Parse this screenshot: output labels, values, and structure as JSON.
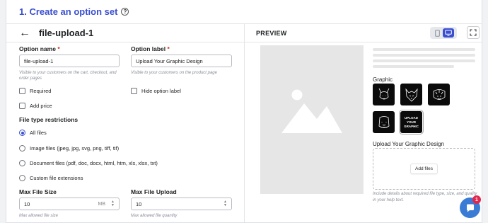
{
  "header": {
    "title": "1. Create an option set",
    "help_glyph": "?"
  },
  "panel": {
    "back_glyph": "←",
    "title": "file-upload-1"
  },
  "form": {
    "option_name": {
      "label": "Option name",
      "required": "*",
      "value": "file-upload-1",
      "help": "Visible to your customers on the cart, checkout, and order pages"
    },
    "option_label": {
      "label": "Option label",
      "required": "*",
      "value": "Upload Your Graphic Design",
      "help": "Visible to your customers on the product page"
    },
    "required_label": "Required",
    "hide_label": "Hide option label",
    "add_price_label": "Add price",
    "file_type_title": "File type restrictions",
    "file_types": [
      {
        "label": "All files",
        "selected": true
      },
      {
        "label": "Image files (jpeg, jpg, svg, png, tiff, tif)",
        "selected": false
      },
      {
        "label": "Document files (pdf, doc, docx, html, htm, xls, xlsx, txt)",
        "selected": false
      },
      {
        "label": "Custom file extensions",
        "selected": false
      }
    ],
    "max_file_size": {
      "label": "Max File Size",
      "value": "10",
      "unit": "MB",
      "help": "Max allowed file size"
    },
    "max_file_upload": {
      "label": "Max File Upload",
      "value": "10",
      "help": "Max allowed file quantity"
    }
  },
  "preview": {
    "title": "PREVIEW",
    "graphic_label": "Graphic",
    "upload_thumb_text": "UPLOAD YOUR GRAPHIC",
    "upload_title": "Upload Your Graphic Design",
    "add_files_label": "Add files",
    "help_text": "Include details about required file type, size, and quality in your help text."
  },
  "chat": {
    "badge": "1"
  },
  "colors": {
    "accent": "#3a4fd0",
    "chat": "#3a7bd5",
    "badge": "#e0284f"
  }
}
